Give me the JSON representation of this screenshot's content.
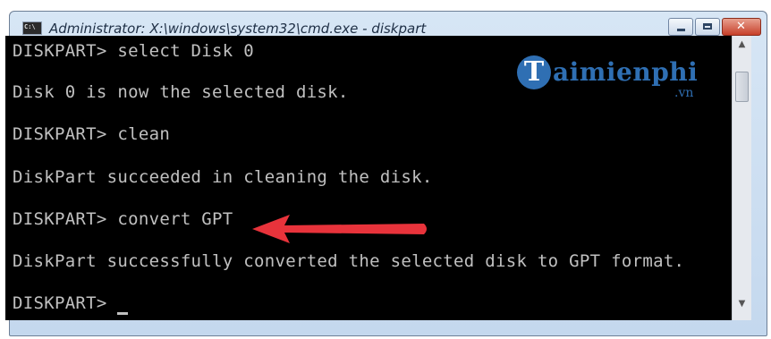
{
  "window": {
    "title": "Administrator: X:\\windows\\system32\\cmd.exe - diskpart",
    "accent": "#c7402a"
  },
  "console": {
    "lines": [
      "DISKPART> select Disk 0",
      "Disk 0 is now the selected disk.",
      "DISKPART> clean",
      "DiskPart succeeded in cleaning the disk.",
      "DISKPART> convert GPT",
      "DiskPart successfully converted the selected disk to GPT format.",
      "DISKPART> "
    ],
    "text_color": "#c0c0c0",
    "background": "#000000"
  },
  "watermark": {
    "letter": "T",
    "brand": "aimienphi",
    "suffix": ".vn",
    "color": "#2f6fb3"
  },
  "annotation": {
    "arrow_color": "#e8333b",
    "points_to": "DISKPART> convert GPT"
  },
  "icons": [
    "cmd-app-icon",
    "minimize-icon",
    "maximize-icon",
    "close-icon",
    "scroll-up-icon",
    "scroll-down-icon"
  ]
}
